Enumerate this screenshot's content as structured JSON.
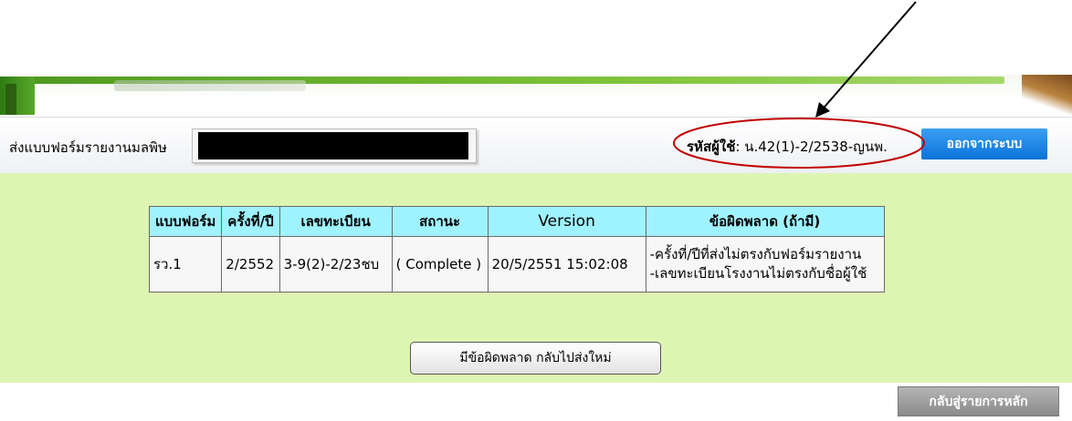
{
  "header": {
    "send_label": "ส่งแบบฟอร์มรายงานมลพิษ",
    "userid_label": "รหัสผู้ใช้",
    "userid_value": ": น.42(1)-2/2538-ญนพ.",
    "logout": "ออกจากระบบ"
  },
  "table": {
    "headers": [
      "แบบฟอร์ม",
      "ครั้งที่/ปี",
      "เลขทะเบียน",
      "สถานะ",
      "Version",
      "ข้อผิดพลาด (ถ้ามี)"
    ],
    "rows": [
      {
        "form": "รว.1",
        "period": "2/2552",
        "reg_no": "3-9(2)-2/23ชบ",
        "status": "( Complete )",
        "version": "20/5/2551 15:02:08",
        "errors": [
          "-ครั้งที่/ปีที่ส่งไม่ตรงกับฟอร์มรายงาน",
          "-เลขทะเบียนโรงงานไม่ตรงกับชื่อผู้ใช้"
        ]
      }
    ]
  },
  "buttons": {
    "resend": "มีข้อผิดพลาด กลับไปส่งใหม่",
    "back": "กลับสู่รายการหลัก"
  },
  "colors": {
    "content_bg": "#ddf5b2",
    "header_cell": "#9ff2ff",
    "logout_bg": "#0b72d9",
    "annotation_red": "#c00000"
  }
}
